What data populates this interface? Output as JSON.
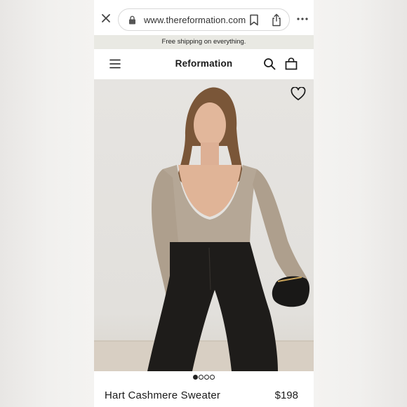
{
  "browser": {
    "url": "www.thereformation.com",
    "icons": {
      "close": "close-icon",
      "lock": "lock-icon",
      "bookmark": "bookmark-icon",
      "share": "share-icon",
      "more": "more-icon"
    }
  },
  "banner": {
    "text": "Free shipping on everything."
  },
  "header": {
    "brand": "Reformation",
    "icons": {
      "menu": "menu-icon",
      "search": "search-icon",
      "bag": "bag-icon"
    }
  },
  "product": {
    "name": "Hart Cashmere Sweater",
    "price": "$198",
    "image_count": 4,
    "active_image": 1,
    "favorite_icon": "heart-icon"
  },
  "colors": {
    "banner_bg": "#e9e9e3",
    "text": "#1a1a1a"
  }
}
